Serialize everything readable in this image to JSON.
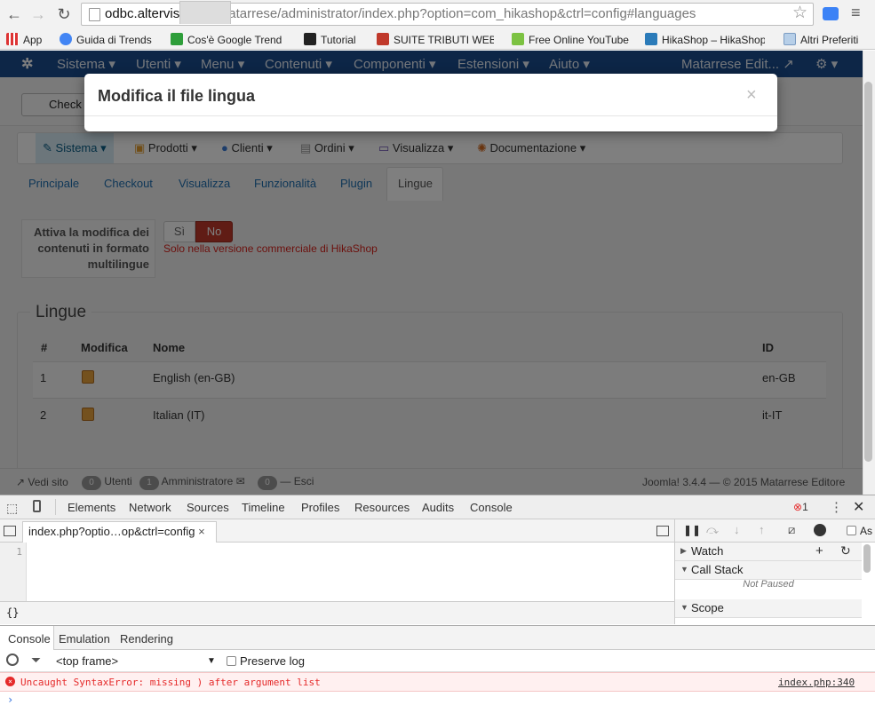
{
  "browser": {
    "url_host": "odbc.altervista.org",
    "url_path": "/matarrese/administrator/index.php?option=com_hikashop&ctrl=config#languages",
    "bookmarks": [
      "App",
      "Guida di Trends",
      "Cos'è Google Trend",
      "Tutorial",
      "SUITE TRIBUTI WEB",
      "Free Online YouTube",
      "HikaShop – HikaShop",
      "Altri Preferiti"
    ]
  },
  "admin": {
    "nav": [
      "Sistema",
      "Utenti",
      "Menu",
      "Contenuti",
      "Componenti",
      "Estensioni",
      "Aiuto"
    ],
    "site_name": "Matarrese Edit...",
    "check_button": "Check"
  },
  "hikashop": {
    "menu": [
      "Sistema",
      "Prodotti",
      "Clienti",
      "Ordini",
      "Visualizza",
      "Documentazione"
    ],
    "tabs": [
      "Principale",
      "Checkout",
      "Visualizza",
      "Funzionalità",
      "Plugin",
      "Lingue"
    ],
    "option_label": "Attiva la modifica dei contenuti in formato multilingue",
    "toggle_yes": "Sì",
    "toggle_no": "No",
    "notice": "Solo nella versione commerciale di HikaShop",
    "languages_title": "Lingue",
    "table_headers": [
      "#",
      "Modifica",
      "Nome",
      "ID"
    ],
    "rows": [
      {
        "num": "1",
        "name": "English (en-GB)",
        "id": "en-GB"
      },
      {
        "num": "2",
        "name": "Italian (IT)",
        "id": "it-IT"
      }
    ]
  },
  "statusbar": {
    "view_site": "Vedi sito",
    "users_count": "0",
    "users_label": "Utenti",
    "admins_count": "1",
    "admins_label": "Amministratore",
    "messages_count": "0",
    "logout": "Esci",
    "footer": "Joomla! 3.4.4 — © 2015 Matarrese Editore"
  },
  "modal": {
    "title": "Modifica il file lingua",
    "close": "×"
  },
  "devtools": {
    "tabs": [
      "Elements",
      "Network",
      "Sources",
      "Timeline",
      "Profiles",
      "Resources",
      "Audits",
      "Console"
    ],
    "error_count": "1",
    "file_tab": "index.php?optio…op&ctrl=config",
    "line_number": "1",
    "format_button": "{}",
    "panes": {
      "watch": "Watch",
      "call_stack": "Call Stack",
      "not_paused": "Not Paused",
      "scope": "Scope"
    },
    "async_label": "As",
    "drawer_tabs": [
      "Console",
      "Emulation",
      "Rendering"
    ],
    "frame_select": "<top frame>",
    "preserve_log": "Preserve log",
    "error_message": "Uncaught SyntaxError: missing ) after argument list",
    "error_source": "index.php:340",
    "prompt": "›"
  }
}
